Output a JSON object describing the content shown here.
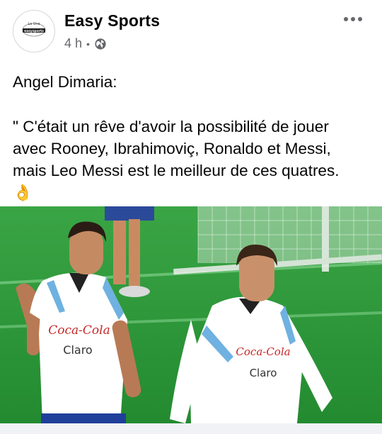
{
  "post": {
    "page_name": "Easy Sports",
    "time": "4 h",
    "separator": "•",
    "avatar_text_top": "La Une",
    "avatar_text_badge": "easysports",
    "author_line": "Angel Dimaria:",
    "quote_line_1": "\" C'était un rêve d'avoir la possibilité de jouer",
    "quote_line_2": "avec Rooney, Ibrahimoviç, Ronaldo et Messi,",
    "quote_line_3": "mais Leo Messi est le meilleur de ces quatres.",
    "emoji": "👌"
  },
  "photo": {
    "jersey_sponsor": "Coca-Cola",
    "jersey_brand": "Claro",
    "jersey_brand_dot": "·"
  },
  "icons": {
    "visibility": "globe-icon",
    "menu": "more-options-icon"
  },
  "colors": {
    "pitch": "#2e9a3a",
    "jersey_blue": "#6fb1e0",
    "text_primary": "#050505",
    "text_secondary": "#65676b"
  }
}
